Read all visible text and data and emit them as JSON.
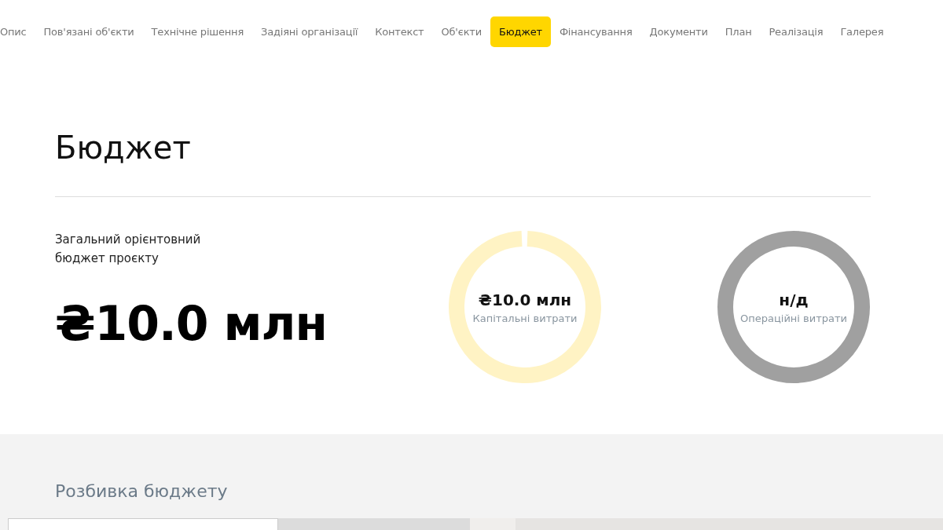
{
  "nav": [
    {
      "label": "Опис",
      "selected": false
    },
    {
      "label": "Пов'язані об'єкти",
      "selected": false
    },
    {
      "label": "Технічне рішення",
      "selected": false
    },
    {
      "label": "Задіяні організації",
      "selected": false
    },
    {
      "label": "Контекст",
      "selected": false
    },
    {
      "label": "Об'єкти",
      "selected": false
    },
    {
      "label": "Бюджет",
      "selected": true
    },
    {
      "label": "Фінансування",
      "selected": false
    },
    {
      "label": "Документи",
      "selected": false
    },
    {
      "label": "План",
      "selected": false
    },
    {
      "label": "Реалізація",
      "selected": false
    },
    {
      "label": "Галерея",
      "selected": false
    }
  ],
  "section": {
    "title": "Бюджет",
    "total": {
      "label": "Загальний орієнтовний бюджет проєкту",
      "value": "₴10.0 млн"
    },
    "rings": [
      {
        "kind": "filled",
        "value": "₴10.0 млн",
        "label": "Капітальні витрати"
      },
      {
        "kind": "empty",
        "value": "н/д",
        "label": "Операційні витрати"
      }
    ]
  },
  "breakdown": {
    "title": "Розбивка бюджету"
  }
}
